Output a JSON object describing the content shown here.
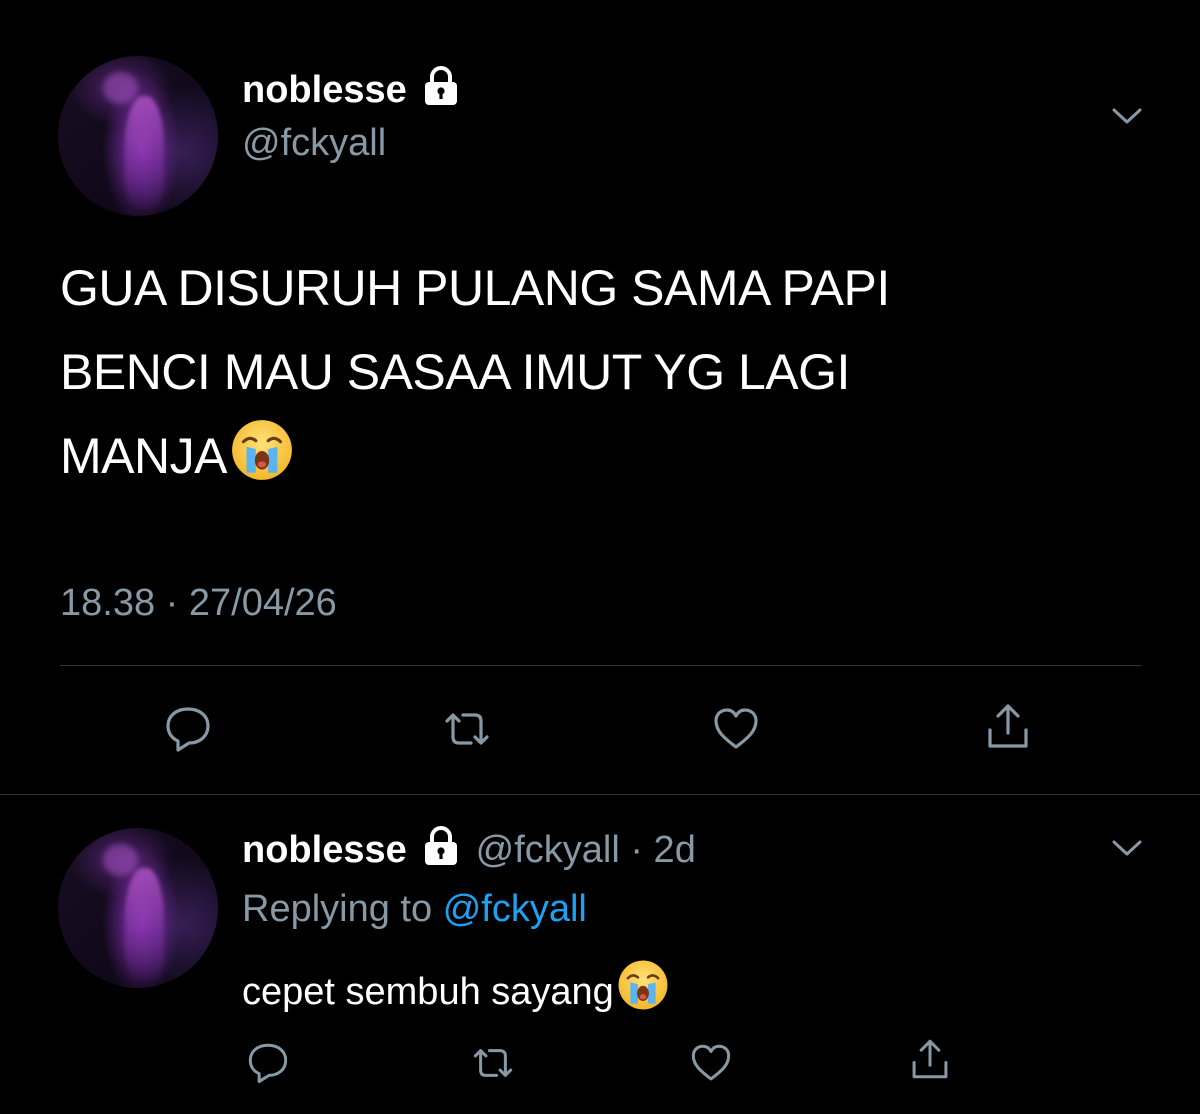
{
  "main_tweet": {
    "display_name": "noblesse",
    "handle": "@fckyall",
    "lines": [
      "GUA DISURUH PULANG SAMA PAPI",
      "BENCI MAU SASAA IMUT YG LAGI",
      "MANJA"
    ],
    "timestamp": "18.38 · 27/04/26"
  },
  "reply_tweet": {
    "display_name": "noblesse",
    "handle_time": "@fckyall · 2d",
    "replying_prefix": "Replying to",
    "replying_handle": "@fckyall",
    "text": "cepet sembuh sayang"
  },
  "icons": {
    "lock": "lock-icon",
    "more": "chevron-down-icon",
    "reply": "comment-icon",
    "retweet": "retweet-icon",
    "like": "heart-icon",
    "share": "share-icon",
    "emoji": "loudly-crying-face-emoji"
  },
  "colors": {
    "background": "#000000",
    "text": "#ffffff",
    "secondary": "#8899a6",
    "link": "#1da1f2",
    "divider": "#2f3336"
  }
}
